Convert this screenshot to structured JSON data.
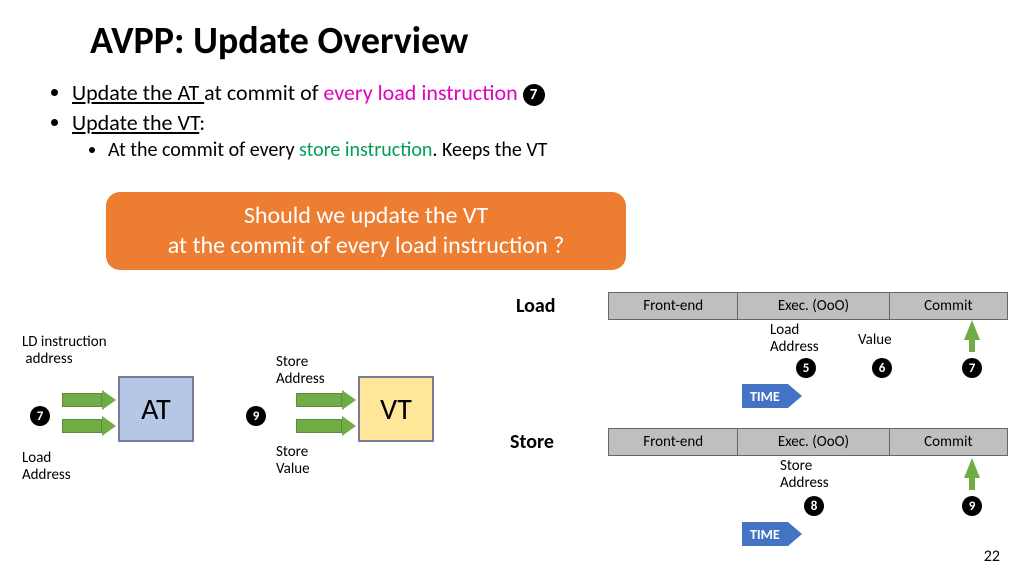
{
  "title": "AVPP: Update Overview",
  "bullet1_pre": "Update the AT ",
  "bullet1_mid": "at commit of ",
  "bullet1_load": "every load instruction",
  "bullet2": "Update the VT",
  "sub1_pre": "At the commit of every ",
  "sub1_store": "store instruction",
  "sub1_post": ". Keeps the VT",
  "sub2": " ",
  "callout_l1": "Should we update the VT",
  "callout_l2": "at the commit of every load instruction ?",
  "pipeline": {
    "load_label": "Load",
    "store_label": "Store",
    "stages": [
      "Front-end",
      "Exec. (OoO)",
      "Commit"
    ],
    "load_ann": {
      "addr": "Load\nAddress",
      "value": "Value"
    },
    "store_ann": {
      "addr": "Store\nAddress"
    },
    "time": "TIME"
  },
  "tables": {
    "at": {
      "name": "AT",
      "in1": "LD instruction\n address",
      "in2": "Load\nAddress"
    },
    "vt": {
      "name": "VT",
      "in1": "Store\nAddress",
      "in2": "Store\nValue"
    }
  },
  "nums": {
    "n5": "5",
    "n6": "6",
    "n7": "7",
    "n8": "8",
    "n9": "9"
  },
  "page": "22"
}
